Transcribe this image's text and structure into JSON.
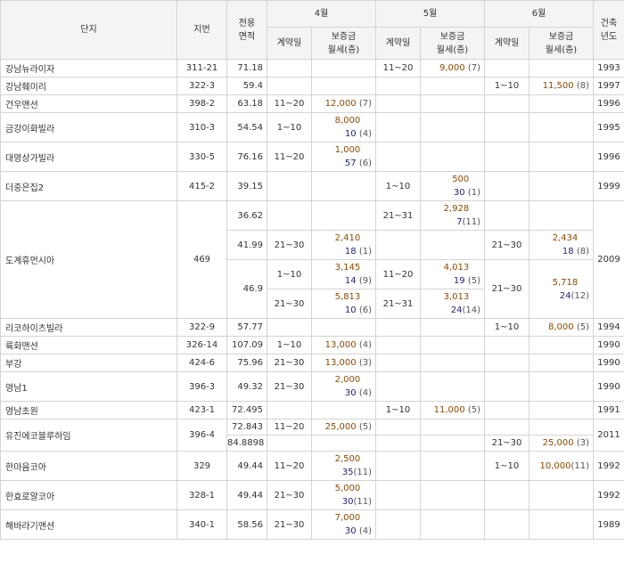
{
  "headers": {
    "complex": "단지",
    "lot": "지번",
    "area": "전용\n면적",
    "months": [
      "4월",
      "5월",
      "6월"
    ],
    "contract_date": "계약일",
    "deposit_rent": "보증금\n월세(층)",
    "built_year": "건축\n년도"
  },
  "rows": {
    "r1": {
      "name": "강남뉴라이자",
      "lot": "311-21",
      "area": "71.18",
      "m5_date": "11~20",
      "m5_amt": "9,000",
      "m5_cnt": "(7)",
      "year": "1993"
    },
    "r2": {
      "name": "강남훼미리",
      "lot": "322-3",
      "area": "59.4",
      "m6_date": "1~10",
      "m6_amt": "11,500",
      "m6_cnt": "(8)",
      "year": "1997"
    },
    "r3": {
      "name": "건우맨션",
      "lot": "398-2",
      "area": "63.18",
      "m4_date": "11~20",
      "m4_amt": "12,000",
      "m4_cnt": "(7)",
      "year": "1996"
    },
    "r4": {
      "name": "금강이화빌라",
      "lot": "310-3",
      "area": "54.54",
      "m4_date": "1~10",
      "m4_amt": "8,000",
      "m4_rent": "10",
      "m4_cnt": "(4)",
      "year": "1995"
    },
    "r5": {
      "name": "대영상가빌라",
      "lot": "330-5",
      "area": "76.16",
      "m4_date": "11~20",
      "m4_amt": "1,000",
      "m4_rent": "57",
      "m4_cnt": "(6)",
      "year": "1996"
    },
    "r6": {
      "name": "더중은집2",
      "lot": "415-2",
      "area": "39.15",
      "m5_date": "1~10",
      "m5_amt": "500",
      "m5_rent": "30",
      "m5_cnt": "(1)",
      "year": "1999"
    },
    "r7": {
      "name": "도계휴먼시아",
      "lot": "469",
      "year": "2009",
      "a1": {
        "area": "36.62",
        "m5_date": "21~31",
        "m5_amt": "2,928",
        "m5_rent": "7",
        "m5_cnt": "(11)"
      },
      "a2": {
        "area": "41.99",
        "m4_date": "21~30",
        "m4_amt": "2,410",
        "m4_rent": "18",
        "m4_cnt": "(1)",
        "m6_date": "21~30",
        "m6_amt": "2,434",
        "m6_rent": "18",
        "m6_cnt": "(8)"
      },
      "a3": {
        "area": "46.9",
        "s1": {
          "m4_date": "1~10",
          "m4_amt": "3,145",
          "m4_rent": "14",
          "m4_cnt": "(9)",
          "m5_date": "11~20",
          "m5_amt": "4,013",
          "m5_rent": "19",
          "m5_cnt": "(5)"
        },
        "s2": {
          "m4_date": "21~30",
          "m4_amt": "5,813",
          "m4_rent": "10",
          "m4_cnt": "(6)",
          "m5_date": "21~31",
          "m5_amt": "3,013",
          "m5_rent": "24",
          "m5_cnt": "(14)"
        },
        "m6_date": "21~30",
        "m6_amt": "5,718",
        "m6_rent": "24",
        "m6_cnt": "(12)"
      }
    },
    "r8": {
      "name": "리코하이츠빌라",
      "lot": "322-9",
      "area": "57.77",
      "m6_date": "1~10",
      "m6_amt": "8,000",
      "m6_cnt": "(5)",
      "year": "1994"
    },
    "r9": {
      "name": "륙화맨션",
      "lot": "326-14",
      "area": "107.09",
      "m4_date": "1~10",
      "m4_amt": "13,000",
      "m4_cnt": "(4)",
      "year": "1990"
    },
    "r10": {
      "name": "부강",
      "lot": "424-6",
      "area": "75.96",
      "m4_date": "21~30",
      "m4_amt": "13,000",
      "m4_cnt": "(3)",
      "year": "1990"
    },
    "r11": {
      "name": "영남1",
      "lot": "396-3",
      "area": "49.32",
      "m4_date": "21~30",
      "m4_amt": "2,000",
      "m4_rent": "30",
      "m4_cnt": "(4)",
      "year": "1990"
    },
    "r12": {
      "name": "영남초원",
      "lot": "423-1",
      "area": "72.495",
      "m5_date": "1~10",
      "m5_amt": "11,000",
      "m5_cnt": "(5)",
      "year": "1991"
    },
    "r13": {
      "name": "유진에코블루하임",
      "lot": "396-4",
      "year": "2011",
      "a1": {
        "area": "72.843",
        "m4_date": "11~20",
        "m4_amt": "25,000",
        "m4_cnt": "(5)"
      },
      "a2": {
        "area": "84.8898",
        "m6_date": "21~30",
        "m6_amt": "25,000",
        "m6_cnt": "(3)"
      }
    },
    "r14": {
      "name": "한마음코아",
      "lot": "329",
      "area": "49.44",
      "m4_date": "11~20",
      "m4_amt": "2,500",
      "m4_rent": "35",
      "m4_cnt": "(11)",
      "m6_date": "1~10",
      "m6_amt": "10,000",
      "m6_cnt": "(11)",
      "year": "1992"
    },
    "r15": {
      "name": "한효로얄코아",
      "lot": "328-1",
      "area": "49.44",
      "m4_date": "21~30",
      "m4_amt": "5,000",
      "m4_rent": "30",
      "m4_cnt": "(11)",
      "year": "1992"
    },
    "r16": {
      "name": "해바라기맨션",
      "lot": "340-1",
      "area": "58.56",
      "m4_date": "21~30",
      "m4_amt": "7,000",
      "m4_rent": "30",
      "m4_cnt": "(4)",
      "year": "1989"
    }
  }
}
